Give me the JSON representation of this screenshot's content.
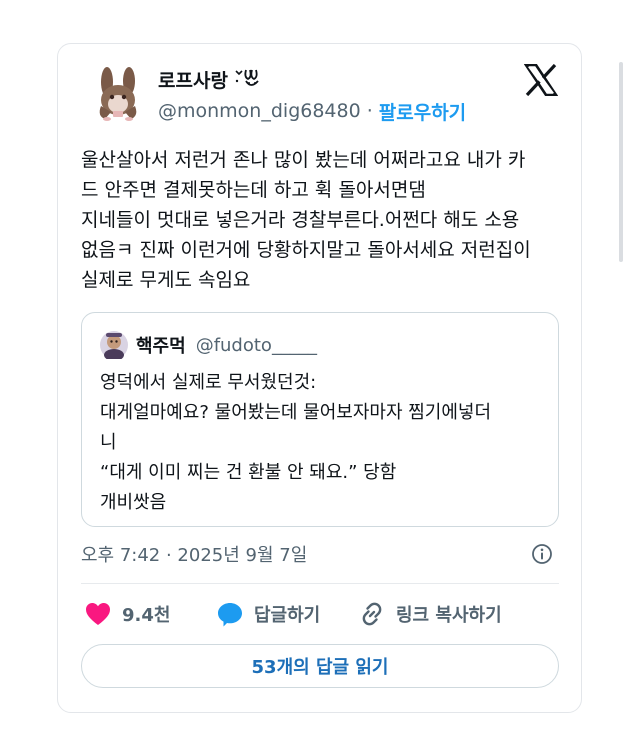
{
  "tweet": {
    "author": {
      "display_name": "로프사랑",
      "handle": "@monmon_dig68480",
      "follow_label": "팔로우하기",
      "separator": "·"
    },
    "text_lines": [
      "울산살아서 저런거 존나 많이 봤는데 어쩌라고요 내가 카",
      "드 안주면 결제못하는데 하고 휙 돌아서면댐",
      "지네들이 멋대로 넣은거라 경찰부른다.어쩐다 해도 소용",
      "없음ㅋ 진짜 이런거에 당황하지말고 돌아서세요 저런집이",
      "실제로 무게도 속임요"
    ],
    "quote": {
      "display_name": "핵주먹",
      "handle": "@fudoto_____",
      "text_lines": [
        "영덕에서 실제로 무서웠던것:",
        "대게얼마예요? 물어봤는데 물어보자마자 찜기에넣더",
        "니",
        "“대게 이미 찌는 건 환불 안 돼요.” 당함",
        "개비쌋음"
      ]
    },
    "timestamp": "오후 7:42 · 2025년 9월 7일",
    "actions": {
      "like_count": "9.4천",
      "reply_label": "답글하기",
      "share_label": "링크 복사하기"
    },
    "read_replies_label": "53개의 답글 읽기"
  },
  "icons": {
    "platform_logo": "x-logo-icon",
    "info": "info-icon",
    "like": "heart-icon",
    "reply": "speech-bubble-icon",
    "share": "link-icon"
  },
  "colors": {
    "accent": "#1d9bf0",
    "like": "#f91880",
    "secondary_text": "#536471",
    "border": "#cfd9de"
  }
}
